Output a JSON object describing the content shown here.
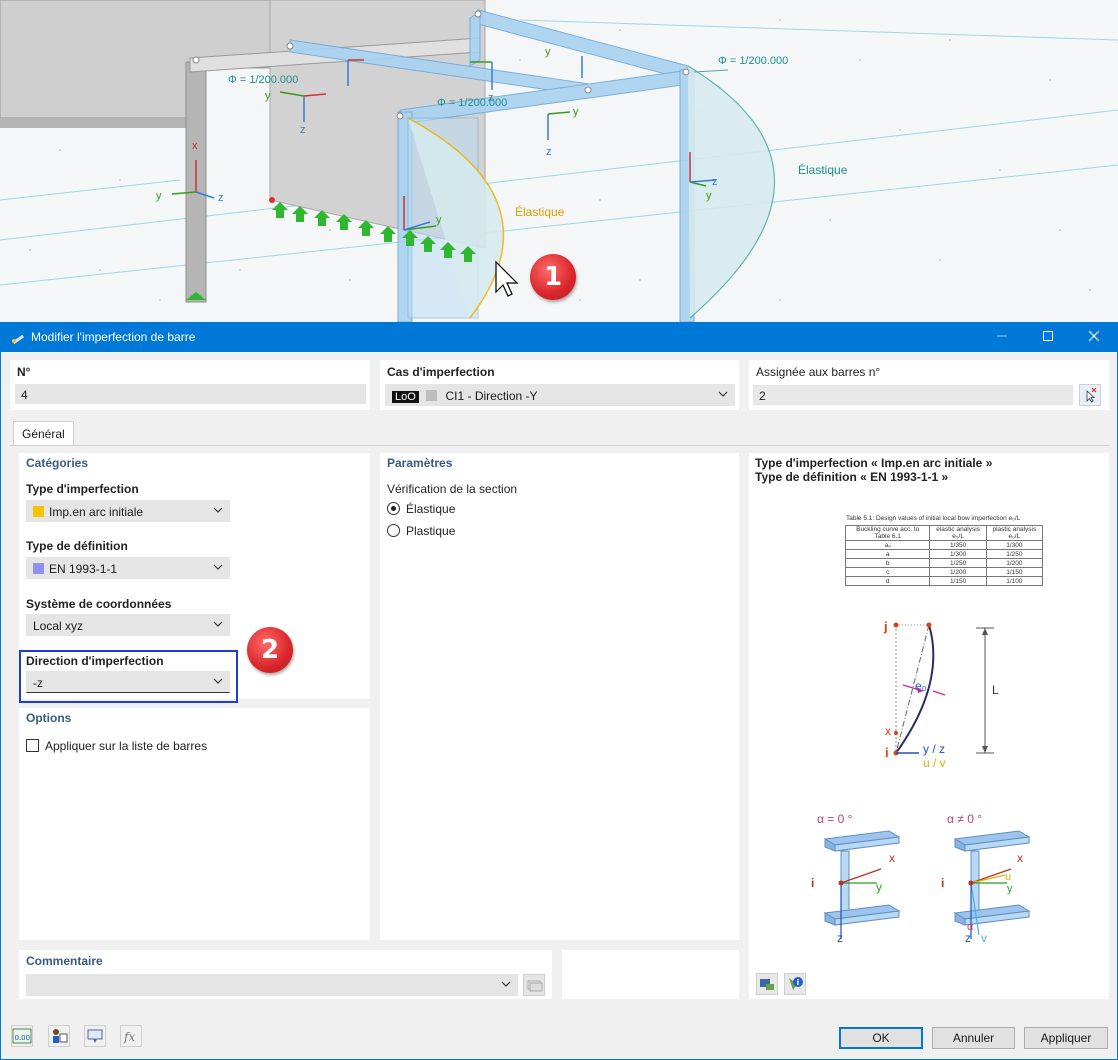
{
  "viewport": {
    "phi_label": "Φ = 1/200.000",
    "elastic_label": "Élastique",
    "axis_x": "x",
    "axis_y": "y",
    "axis_z": "z",
    "callout_1": "1",
    "callout_2": "2"
  },
  "dialog": {
    "title": "Modifier l'imperfection de barre",
    "no": {
      "label": "N°",
      "value": "4"
    },
    "case": {
      "label": "Cas d'imperfection",
      "tag": "LoO",
      "value": "CI1 - Direction -Y"
    },
    "assigned": {
      "label": "Assignée aux barres n°",
      "value": "2"
    },
    "tab_general": "Général",
    "categories": {
      "title": "Catégories",
      "imperfection_type": {
        "label": "Type d'imperfection",
        "value": "Imp.en arc initiale",
        "swatch": "#f5c400"
      },
      "definition_type": {
        "label": "Type de définition",
        "value": "EN 1993-1-1",
        "swatch": "#9090f0"
      },
      "coord_system": {
        "label": "Système de coordonnées",
        "value": "Local xyz"
      },
      "direction": {
        "label": "Direction d'imperfection",
        "value": "-z"
      }
    },
    "options": {
      "title": "Options",
      "apply_list": "Appliquer sur la liste de barres"
    },
    "parameters": {
      "title": "Paramètres",
      "section_check": "Vérification de la section",
      "elastic": "Élastique",
      "plastic": "Plastique"
    },
    "info": {
      "line1": "Type d'imperfection « Imp.en arc initiale »",
      "line2": "Type de définition « EN 1993-1-1 »",
      "table_title": "Table 5.1: Design values of initial local bow imperfection e₀/L",
      "table_header": [
        "Buckling curve acc. to Table 6.1",
        "elastic analysis e₀/L",
        "plastic analysis e₀/L"
      ],
      "table_rows": [
        [
          "a₀",
          "1/350",
          "1/300"
        ],
        [
          "a",
          "1/300",
          "1/250"
        ],
        [
          "b",
          "1/250",
          "1/200"
        ],
        [
          "c",
          "1/200",
          "1/150"
        ],
        [
          "d",
          "1/150",
          "1/100"
        ]
      ],
      "diagram": {
        "j": "j",
        "i": "i",
        "x": "x",
        "e0": "e₀",
        "L": "L",
        "yz": "y / z",
        "uv": "u / v"
      },
      "section_alpha0": "α = 0 °",
      "section_alpha_ne0": "α ≠ 0 °",
      "sec_i": "i",
      "sec_x": "x",
      "sec_y": "y",
      "sec_z": "z",
      "sec_u": "u",
      "sec_v": "v",
      "sec_alpha": "α"
    },
    "comment": {
      "label": "Commentaire",
      "value": ""
    },
    "footer": {
      "ok": "OK",
      "cancel": "Annuler",
      "apply": "Appliquer",
      "units_icon_text": "0.00"
    }
  }
}
